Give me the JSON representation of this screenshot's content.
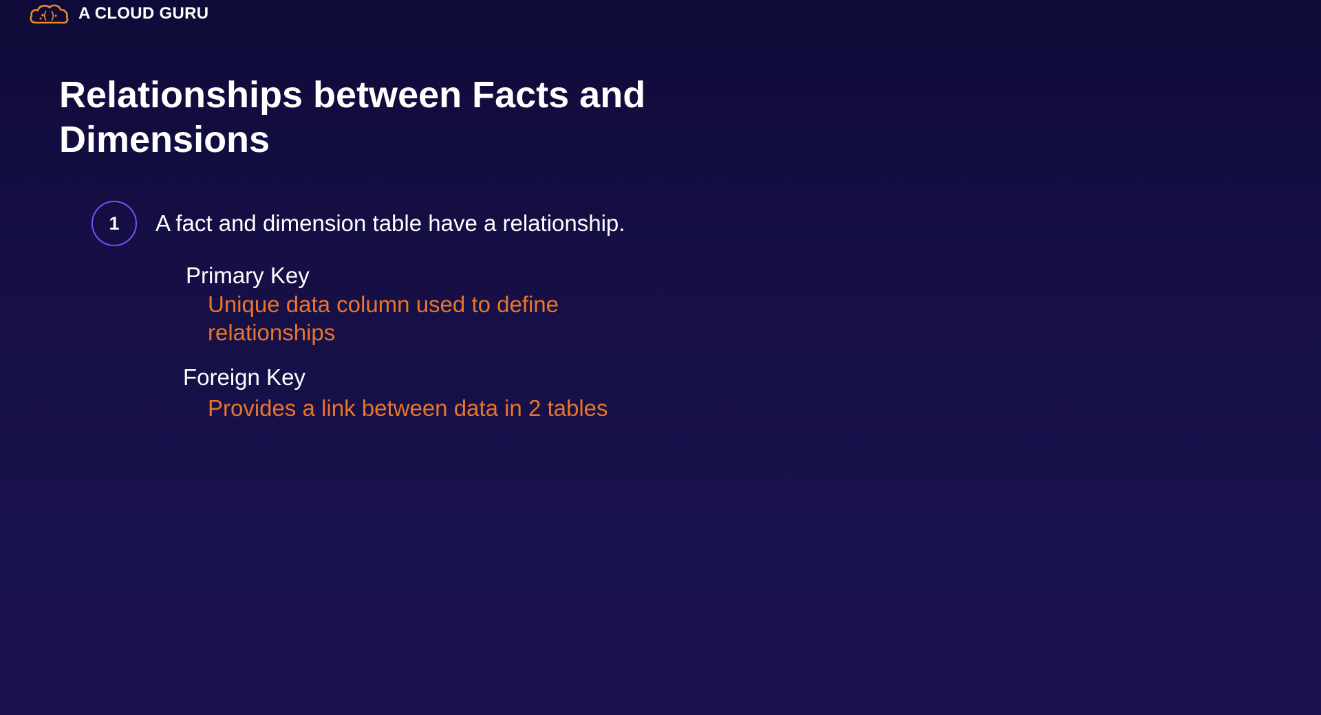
{
  "brand": {
    "name": "A CLOUD GURU",
    "accent_color": "#f08a24",
    "icon": "cloud-logo-icon"
  },
  "slide": {
    "title": "Relationships between Facts and Dimensions",
    "point": {
      "number": "1",
      "text": "A fact and dimension table have a relationship.",
      "badge_color": "#7b4dff"
    },
    "terms": [
      {
        "term": "Primary Key",
        "description": "Unique data column used to define relationships"
      },
      {
        "term": "Foreign Key",
        "description": "Provides a link between data in 2 tables"
      }
    ],
    "description_color": "#e8752a",
    "background_color": "#150f45"
  }
}
